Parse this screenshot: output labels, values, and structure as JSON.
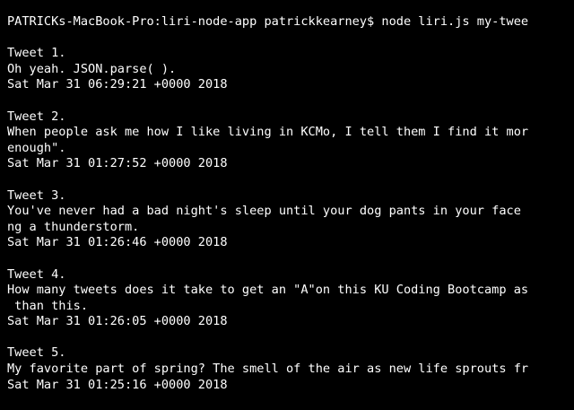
{
  "terminal": {
    "prompt_line": "PATRICKs-MacBook-Pro:liri-node-app patrickkearney$ node liri.js my-twee",
    "tweets": [
      {
        "header": "Tweet 1.",
        "text_lines": [
          "Oh yeah. JSON.parse( )."
        ],
        "date": "Sat Mar 31 06:29:21 +0000 2018"
      },
      {
        "header": "Tweet 2.",
        "text_lines": [
          "When people ask me how I like living in KCMo, I tell them I find it mor",
          "enough\"."
        ],
        "date": "Sat Mar 31 01:27:52 +0000 2018"
      },
      {
        "header": "Tweet 3.",
        "text_lines": [
          "You've never had a bad night's sleep until your dog pants in your face",
          "ng a thunderstorm."
        ],
        "date": "Sat Mar 31 01:26:46 +0000 2018"
      },
      {
        "header": "Tweet 4.",
        "text_lines": [
          "How many tweets does it take to get an \"A\"on this KU Coding Bootcamp as",
          " than this."
        ],
        "date": "Sat Mar 31 01:26:05 +0000 2018"
      },
      {
        "header": "Tweet 5.",
        "text_lines": [
          "My favorite part of spring? The smell of the air as new life sprouts fr"
        ],
        "date": "Sat Mar 31 01:25:16 +0000 2018"
      }
    ],
    "colors": {
      "background": "#000000",
      "text": "#ffffff"
    }
  }
}
